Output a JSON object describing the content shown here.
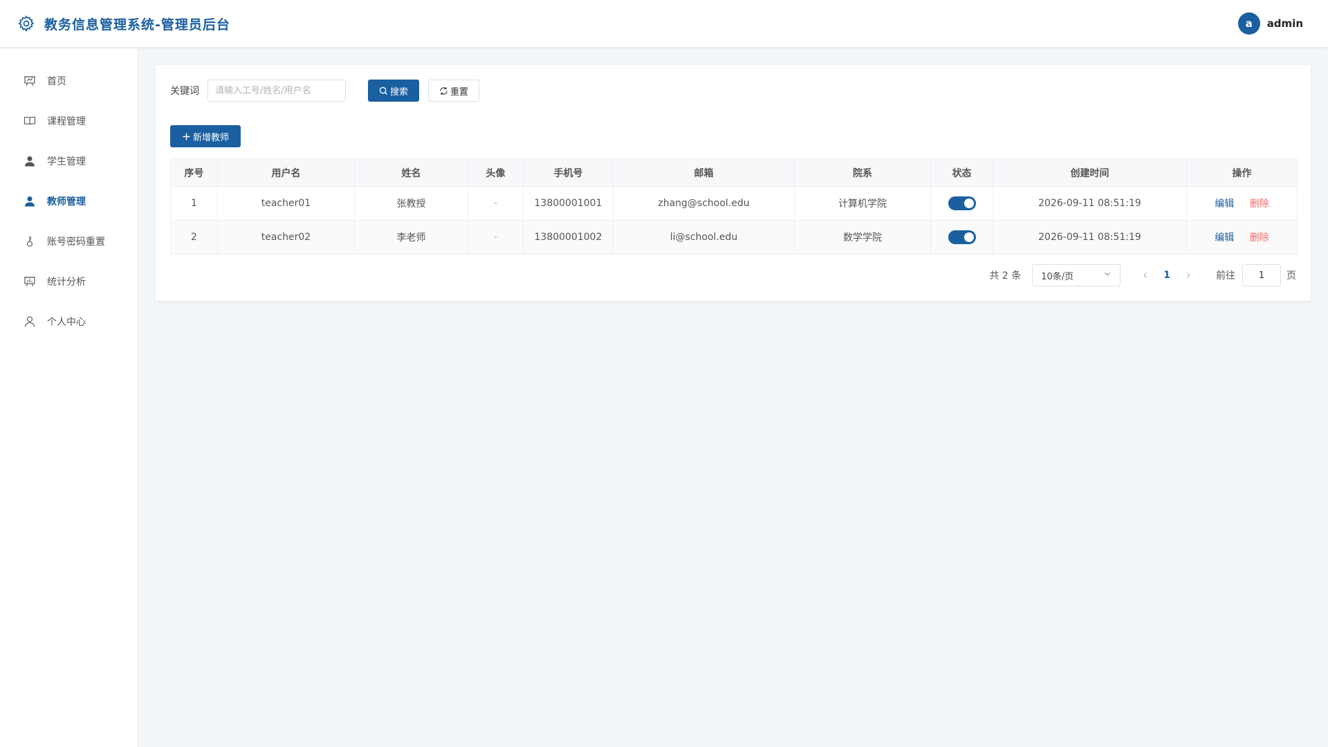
{
  "header": {
    "title": "教务信息管理系统-管理员后台",
    "user": {
      "avatar_letter": "a",
      "name": "admin"
    },
    "accent_color": "#1a5fa0"
  },
  "sidebar": {
    "items": [
      {
        "label": "首页",
        "icon": "dashboard-icon",
        "active": false
      },
      {
        "label": "课程管理",
        "icon": "book-icon",
        "active": false
      },
      {
        "label": "学生管理",
        "icon": "user-icon",
        "active": false
      },
      {
        "label": "教师管理",
        "icon": "user-icon",
        "active": true
      },
      {
        "label": "账号密码重置",
        "icon": "key-icon",
        "active": false
      },
      {
        "label": "统计分析",
        "icon": "chart-icon",
        "active": false
      },
      {
        "label": "个人中心",
        "icon": "person-icon",
        "active": false
      }
    ]
  },
  "search": {
    "label": "关键词",
    "placeholder": "请输入工号/姓名/用户名",
    "value": "",
    "search_label": "搜索",
    "reset_label": "重置"
  },
  "toolbar": {
    "add_label": "新增教师"
  },
  "table": {
    "columns": [
      "序号",
      "用户名",
      "姓名",
      "头像",
      "手机号",
      "邮箱",
      "院系",
      "状态",
      "创建时间",
      "操作"
    ],
    "rows": [
      {
        "index": "1",
        "username": "teacher01",
        "name": "张教授",
        "avatar": "-",
        "phone": "13800001001",
        "email": "zhang@school.edu",
        "dept": "计算机学院",
        "status": true,
        "created": "2026-09-11 08:51:19"
      },
      {
        "index": "2",
        "username": "teacher02",
        "name": "李老师",
        "avatar": "-",
        "phone": "13800001002",
        "email": "li@school.edu",
        "dept": "数学学院",
        "status": true,
        "created": "2026-09-11 08:51:19"
      }
    ],
    "edit_label": "编辑",
    "delete_label": "删除"
  },
  "pagination": {
    "total_text": "共 2 条",
    "page_size": "10条/页",
    "current_page": "1",
    "goto_label": "前往",
    "goto_value": "1",
    "page_unit": "页"
  }
}
